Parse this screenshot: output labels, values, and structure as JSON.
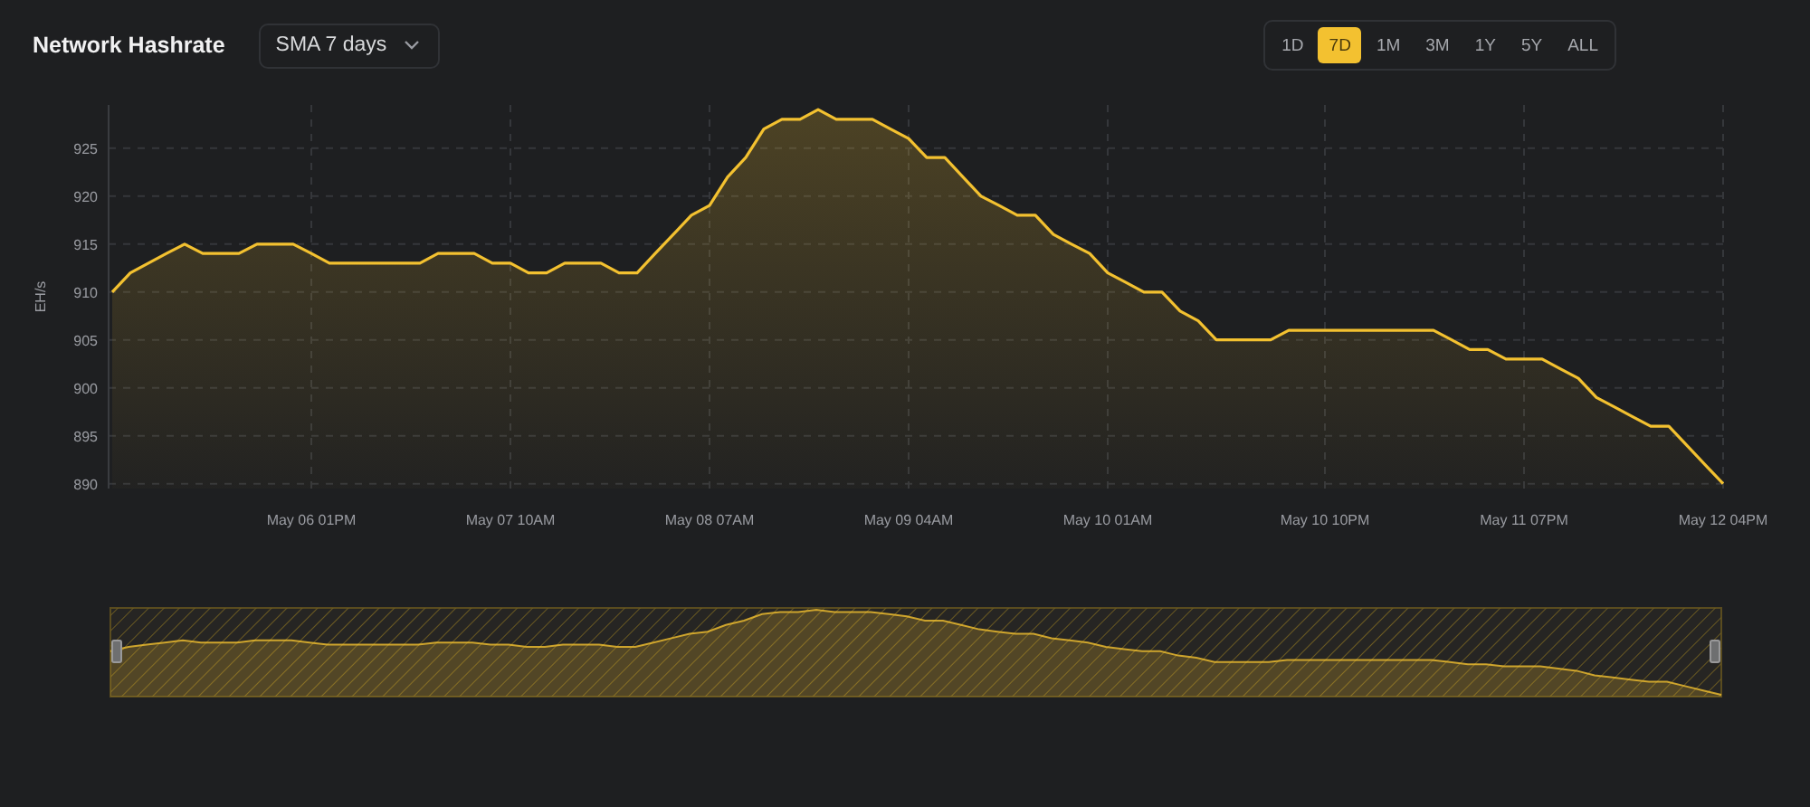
{
  "header": {
    "title": "Network Hashrate",
    "average_select": {
      "value": "SMA 7 days"
    }
  },
  "ranges": [
    {
      "label": "1D",
      "selected": false
    },
    {
      "label": "7D",
      "selected": true
    },
    {
      "label": "1M",
      "selected": false
    },
    {
      "label": "3M",
      "selected": false
    },
    {
      "label": "1Y",
      "selected": false
    },
    {
      "label": "5Y",
      "selected": false
    },
    {
      "label": "ALL",
      "selected": false
    }
  ],
  "chart": {
    "chart_data": {
      "type": "area",
      "ylabel": "EH/s",
      "categories": [
        null,
        null,
        null,
        null,
        null,
        null,
        null,
        null,
        null,
        null,
        null,
        "May 06 01PM",
        null,
        null,
        null,
        null,
        null,
        null,
        null,
        null,
        null,
        null,
        "May 07 10AM",
        null,
        null,
        null,
        null,
        null,
        null,
        null,
        null,
        null,
        null,
        "May 08 07AM",
        null,
        null,
        null,
        null,
        null,
        null,
        null,
        null,
        null,
        null,
        "May 09 04AM",
        null,
        null,
        null,
        null,
        null,
        null,
        null,
        null,
        null,
        null,
        "May 10 01AM",
        null,
        null,
        null,
        null,
        null,
        null,
        null,
        null,
        null,
        null,
        null,
        "May 10 10PM",
        null,
        null,
        null,
        null,
        null,
        null,
        null,
        null,
        null,
        null,
        "May 11 07PM",
        null,
        null,
        null,
        null,
        null,
        null,
        null,
        null,
        null,
        null,
        "May 12 04PM"
      ],
      "series": [
        {
          "color": "#f3c130",
          "values": [
            910,
            912,
            913,
            914,
            915,
            914,
            914,
            914,
            915,
            915,
            915,
            914,
            913,
            913,
            913,
            913,
            913,
            913,
            914,
            914,
            914,
            913,
            913,
            912,
            912,
            913,
            913,
            913,
            912,
            912,
            914,
            916,
            918,
            919,
            922,
            924,
            927,
            928,
            928,
            929,
            928,
            928,
            928,
            927,
            926,
            924,
            924,
            922,
            920,
            919,
            918,
            918,
            916,
            915,
            914,
            912,
            911,
            910,
            910,
            908,
            907,
            905,
            905,
            905,
            905,
            906,
            906,
            906,
            906,
            906,
            906,
            906,
            906,
            906,
            905,
            904,
            904,
            903,
            903,
            903,
            902,
            901,
            899,
            898,
            897,
            896,
            896,
            894,
            892,
            890
          ]
        }
      ],
      "ylim": [
        889.5,
        929.5
      ],
      "grid": true,
      "yticks": [
        890,
        895,
        900,
        905,
        910,
        915,
        920,
        925
      ]
    }
  }
}
